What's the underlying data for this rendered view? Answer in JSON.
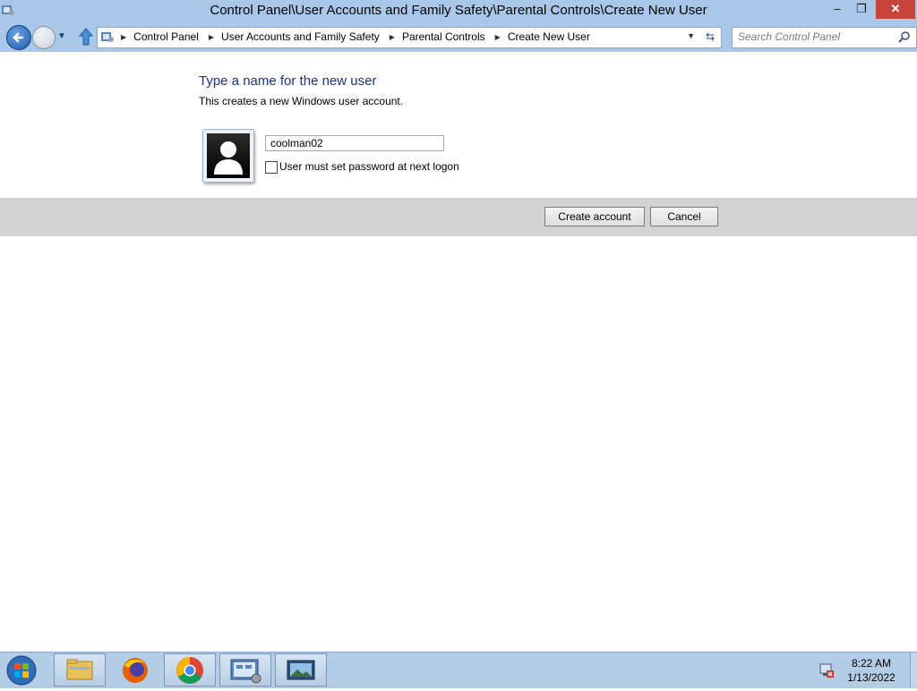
{
  "window": {
    "title": "Control Panel\\User Accounts and Family Safety\\Parental Controls\\Create New User",
    "minimize_glyph": "–",
    "maximize_glyph": "❐",
    "close_glyph": "✕"
  },
  "nav": {
    "breadcrumbs": [
      "Control Panel",
      "User Accounts and Family Safety",
      "Parental Controls",
      "Create New User"
    ],
    "search_placeholder": "Search Control Panel",
    "refresh_glyph": "⇆"
  },
  "content": {
    "heading": "Type a name for the new user",
    "subtext": "This creates a new Windows user account.",
    "username_value": "coolman02",
    "checkbox_label": "User must set password at next logon",
    "checkbox_checked": false
  },
  "buttons": {
    "create": "Create account",
    "cancel": "Cancel"
  },
  "taskbar": {
    "time": "8:22 AM",
    "date": "1/13/2022"
  },
  "colors": {
    "titlebar": "#a9c8e9",
    "heading": "#1e3287",
    "close_button": "#c7443a",
    "band": "#d2d2d2"
  }
}
